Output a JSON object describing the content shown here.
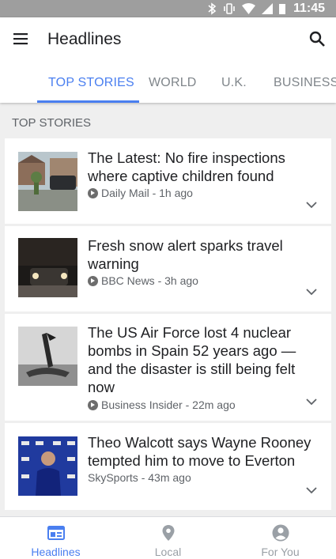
{
  "status_bar": {
    "time": "11:45"
  },
  "app_bar": {
    "title": "Headlines"
  },
  "tabs": [
    {
      "label": "TOP STORIES",
      "active": true
    },
    {
      "label": "WORLD"
    },
    {
      "label": "U.K."
    },
    {
      "label": "BUSINESS"
    }
  ],
  "section": {
    "title": "TOP STORIES"
  },
  "articles": [
    {
      "title": "The Latest: No fire inspections where captive children found",
      "meta": "Daily Mail - 1h ago",
      "thumb_icon": "house-photo"
    },
    {
      "title": "Fresh snow alert sparks travel warning",
      "meta": "BBC News - 3h ago",
      "thumb_icon": "snow-night-car-photo"
    },
    {
      "title": "The US Air Force lost 4 nuclear bombs in Spain 52 years ago — and the disaster is still being felt now",
      "meta": "Business Insider - 22m ago",
      "thumb_icon": "wreckage-photo"
    },
    {
      "title": "Theo Walcott says Wayne Rooney tempted him to move to Everton",
      "meta": "SkySports - 43m ago",
      "thumb_icon": "footballer-photo"
    }
  ],
  "bottom_nav": [
    {
      "label": "Headlines",
      "icon": "newspaper-icon",
      "active": true
    },
    {
      "label": "Local",
      "icon": "location-pin-icon"
    },
    {
      "label": "For You",
      "icon": "person-icon"
    }
  ],
  "colors": {
    "accent": "#4a7ff0",
    "status_bar": "#9e9e9e",
    "background": "#efefef"
  }
}
